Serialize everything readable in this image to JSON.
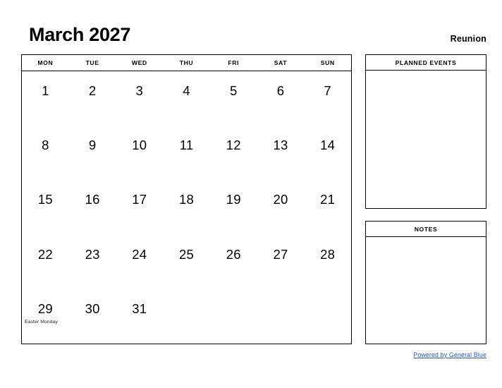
{
  "header": {
    "title": "March 2027",
    "location": "Reunion"
  },
  "calendar": {
    "weekday_headers": [
      "MON",
      "TUE",
      "WED",
      "THU",
      "FRI",
      "SAT",
      "SUN"
    ],
    "weeks": [
      [
        {
          "day": "1",
          "holiday": ""
        },
        {
          "day": "2",
          "holiday": ""
        },
        {
          "day": "3",
          "holiday": ""
        },
        {
          "day": "4",
          "holiday": ""
        },
        {
          "day": "5",
          "holiday": ""
        },
        {
          "day": "6",
          "holiday": ""
        },
        {
          "day": "7",
          "holiday": ""
        }
      ],
      [
        {
          "day": "8",
          "holiday": ""
        },
        {
          "day": "9",
          "holiday": ""
        },
        {
          "day": "10",
          "holiday": ""
        },
        {
          "day": "11",
          "holiday": ""
        },
        {
          "day": "12",
          "holiday": ""
        },
        {
          "day": "13",
          "holiday": ""
        },
        {
          "day": "14",
          "holiday": ""
        }
      ],
      [
        {
          "day": "15",
          "holiday": ""
        },
        {
          "day": "16",
          "holiday": ""
        },
        {
          "day": "17",
          "holiday": ""
        },
        {
          "day": "18",
          "holiday": ""
        },
        {
          "day": "19",
          "holiday": ""
        },
        {
          "day": "20",
          "holiday": ""
        },
        {
          "day": "21",
          "holiday": ""
        }
      ],
      [
        {
          "day": "22",
          "holiday": ""
        },
        {
          "day": "23",
          "holiday": ""
        },
        {
          "day": "24",
          "holiday": ""
        },
        {
          "day": "25",
          "holiday": ""
        },
        {
          "day": "26",
          "holiday": ""
        },
        {
          "day": "27",
          "holiday": ""
        },
        {
          "day": "28",
          "holiday": ""
        }
      ],
      [
        {
          "day": "29",
          "holiday": "Easter Monday"
        },
        {
          "day": "30",
          "holiday": ""
        },
        {
          "day": "31",
          "holiday": ""
        },
        {
          "day": "",
          "holiday": ""
        },
        {
          "day": "",
          "holiday": ""
        },
        {
          "day": "",
          "holiday": ""
        },
        {
          "day": "",
          "holiday": ""
        }
      ]
    ]
  },
  "sidebar": {
    "planned_events_title": "PLANNED EVENTS",
    "notes_title": "NOTES"
  },
  "footer": {
    "link_text": "Powered by General Blue",
    "link_color": "#2a56c6"
  }
}
